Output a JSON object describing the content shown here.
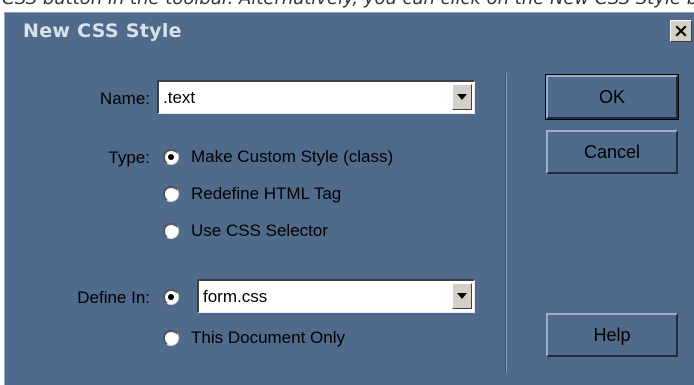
{
  "top_strip": {
    "text": "CSS button in the toolbar. Alternatively, you can click on the New CSS Style button in the Style sheet panel."
  },
  "window": {
    "title": "New CSS Style",
    "close_icon": "close-x-icon"
  },
  "name_field": {
    "label": "Name:",
    "value": ".text"
  },
  "type": {
    "label": "Type:",
    "options": [
      {
        "label": "Make Custom Style (class)",
        "checked": true
      },
      {
        "label": "Redefine HTML Tag",
        "checked": false
      },
      {
        "label": "Use CSS Selector",
        "checked": false
      }
    ]
  },
  "define_in": {
    "label": "Define In:",
    "file_value": "form.css",
    "file_checked": true,
    "this_doc_label": "This Document Only",
    "this_doc_checked": false
  },
  "buttons": {
    "ok": "OK",
    "cancel": "Cancel",
    "help": "Help"
  },
  "colors": {
    "dialog_bg": "#506a8c",
    "title_text": "#d9e1ec"
  }
}
